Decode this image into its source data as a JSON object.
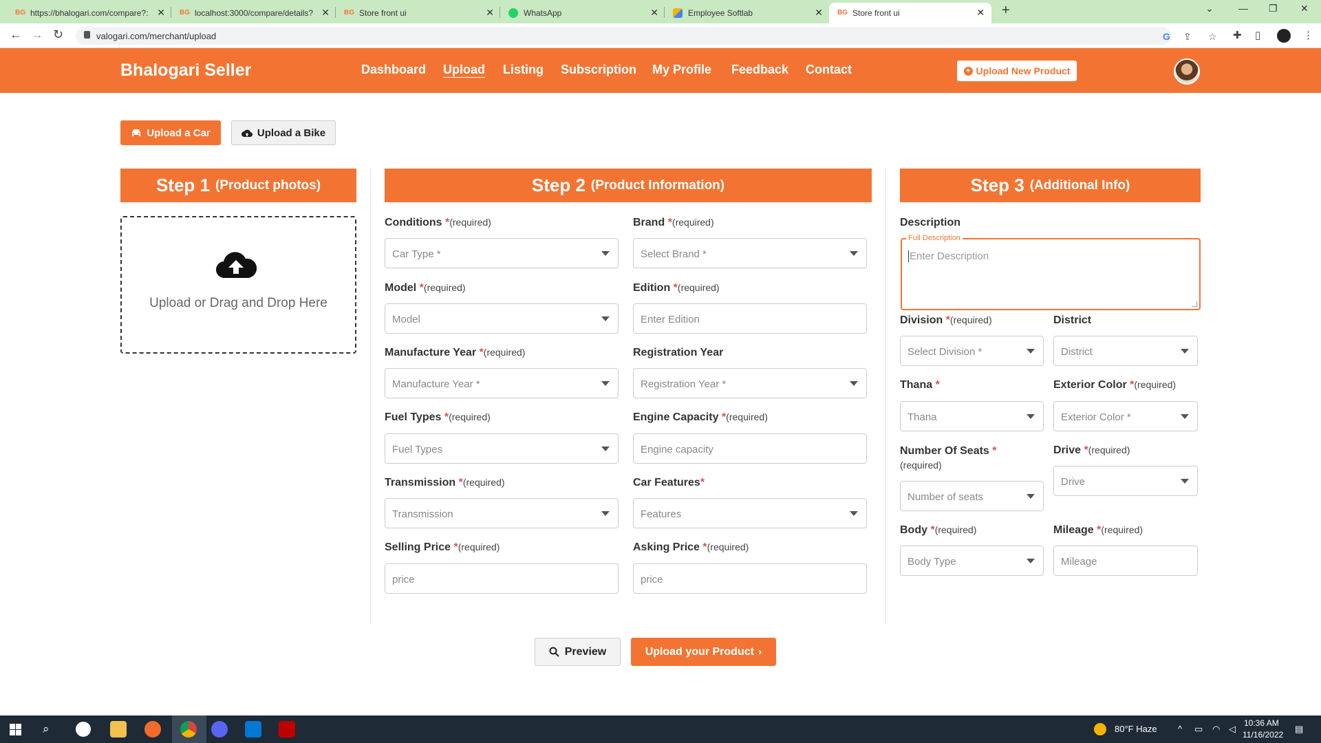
{
  "browser": {
    "tabs": [
      {
        "title": "https://bhalogari.com/compare?:"
      },
      {
        "title": "localhost:3000/compare/details?"
      },
      {
        "title": "Store front ui"
      },
      {
        "title": "WhatsApp"
      },
      {
        "title": "Employee Softlab"
      },
      {
        "title": "Store front ui"
      }
    ],
    "url": "valogari.com/merchant/upload"
  },
  "header": {
    "brand": "Bhalogari Seller",
    "nav": [
      "Dashboard",
      "Upload",
      "Listing",
      "Subscription",
      "My Profile",
      "Feedback",
      "Contact"
    ],
    "active_nav": "Upload",
    "upload_new": "Upload New Product"
  },
  "upload_type": {
    "car": "Upload a Car",
    "bike": "Upload a Bike"
  },
  "step1": {
    "num": "Step 1",
    "sub": "(Product photos)",
    "dropzone_text": "Upload or Drag and Drop Here"
  },
  "step2": {
    "num": "Step 2",
    "sub": "(Product Information)",
    "fields": {
      "conditions": {
        "label": "Conditions",
        "req": "(required)",
        "placeholder": "Car Type *"
      },
      "brand": {
        "label": "Brand",
        "req": "(required)",
        "placeholder": "Select Brand *"
      },
      "model": {
        "label": "Model",
        "req": "(required)",
        "placeholder": "Model"
      },
      "edition": {
        "label": "Edition",
        "req": "(required)",
        "placeholder": "Enter Edition"
      },
      "manufacture_year": {
        "label": "Manufacture Year",
        "req": "(required)",
        "placeholder": "Manufacture Year *"
      },
      "registration_year": {
        "label": "Registration Year",
        "placeholder": "Registration Year *"
      },
      "fuel_types": {
        "label": "Fuel Types",
        "req": "(required)",
        "placeholder": "Fuel Types"
      },
      "engine_capacity": {
        "label": "Engine Capacity",
        "req": "(required)",
        "placeholder": "Engine capacity"
      },
      "transmission": {
        "label": "Transmission",
        "req": "(required)",
        "placeholder": "Transmission"
      },
      "car_features": {
        "label": "Car Features",
        "placeholder": "Features"
      },
      "selling_price": {
        "label": "Selling Price",
        "req": "(required)",
        "placeholder": "price"
      },
      "asking_price": {
        "label": "Asking Price",
        "req": "(required)",
        "placeholder": "price"
      }
    }
  },
  "step3": {
    "num": "Step 3",
    "sub": "(Additional Info)",
    "description": {
      "label": "Description",
      "float_label": "Full Description",
      "placeholder": "Enter Description"
    },
    "fields": {
      "division": {
        "label": "Division",
        "req": "(required)",
        "placeholder": "Select Division *"
      },
      "district": {
        "label": "District",
        "placeholder": "District"
      },
      "thana": {
        "label": "Thana",
        "placeholder": "Thana"
      },
      "exterior_color": {
        "label": "Exterior Color",
        "req": "(required)",
        "placeholder": "Exterior Color *"
      },
      "number_of_seats": {
        "label": "Number Of Seats",
        "req": "(required)",
        "placeholder": "Number of seats"
      },
      "drive": {
        "label": "Drive",
        "req": "(required)",
        "placeholder": "Drive"
      },
      "body": {
        "label": "Body",
        "req": "(required)",
        "placeholder": "Body Type"
      },
      "mileage": {
        "label": "Mileage",
        "req": "(required)",
        "placeholder": "Mileage"
      }
    }
  },
  "actions": {
    "preview": "Preview",
    "upload": "Upload your Product"
  },
  "taskbar": {
    "weather": "80°F  Haze",
    "time": "10:36 AM",
    "date": "11/16/2022"
  },
  "colors": {
    "accent": "#f37432",
    "required_star": "#d9534f",
    "tabbar": "#c9e9c3",
    "taskbar": "#1e2a36"
  }
}
